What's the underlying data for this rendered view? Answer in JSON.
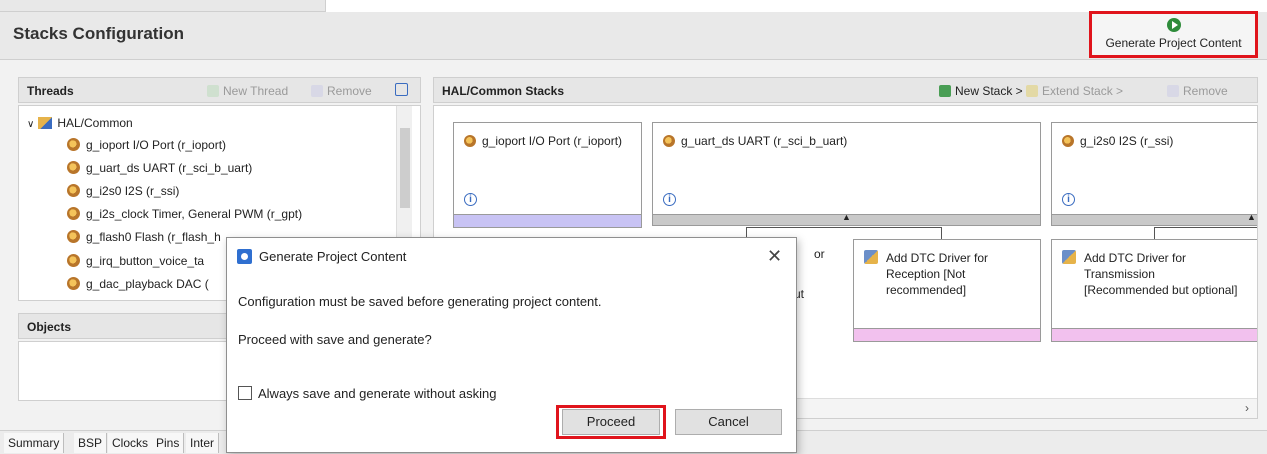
{
  "header": {
    "title": "Stacks Configuration",
    "generate_label": "Generate Project Content"
  },
  "threads": {
    "title": "Threads",
    "new_thread": "New Thread",
    "remove": "Remove",
    "tree": [
      "HAL/Common",
      "g_ioport I/O Port (r_ioport)",
      "g_uart_ds UART (r_sci_b_uart)",
      "g_i2s0 I2S (r_ssi)",
      "g_i2s_clock Timer, General PWM (r_gpt)",
      "g_flash0 Flash (r_flash_h",
      "g_irq_button_voice_ta",
      "g_dac_playback DAC ("
    ]
  },
  "objects": {
    "title": "Objects"
  },
  "stacks": {
    "title": "HAL/Common Stacks",
    "new_stack": "New Stack >",
    "extend_stack": "Extend Stack >",
    "remove": "Remove",
    "cards": [
      {
        "title": "g_ioport I/O Port (r_ioport)"
      },
      {
        "title": "g_uart_ds UART (r_sci_b_uart)"
      },
      {
        "title": "g_i2s0 I2S (r_ssi)"
      }
    ],
    "sub_cards": [
      {
        "title": "Add DTC Driver for Reception [Not recommended]"
      },
      {
        "title": "Add DTC Driver for Transmission [Recommended but optional]"
      }
    ],
    "partial_text": {
      "a": "or",
      "b": "ut"
    }
  },
  "bottom_tabs": [
    "Summary",
    "BSP",
    "Clocks",
    "Pins",
    "Inter"
  ],
  "dialog": {
    "title": "Generate Project Content",
    "message1": "Configuration must be saved before generating project content.",
    "message2": "Proceed with save and generate?",
    "checkbox_label": "Always save and generate without asking",
    "proceed": "Proceed",
    "cancel": "Cancel"
  },
  "colors": {
    "highlight": "#e0141c",
    "lilac": "#c8c3f4",
    "pink": "#f2c1ee"
  }
}
